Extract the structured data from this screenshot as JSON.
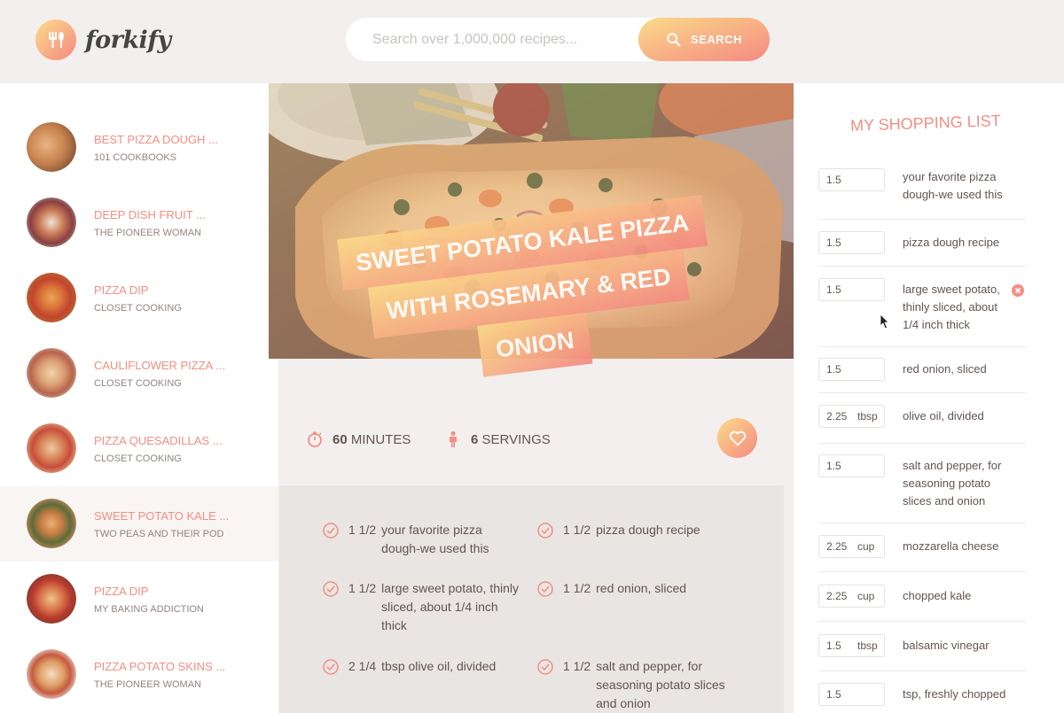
{
  "app": {
    "name": "forkify"
  },
  "search": {
    "placeholder": "Search over 1,000,000 recipes...",
    "button_label": "SEARCH"
  },
  "results": [
    {
      "title": "BEST PIZZA DOUGH ...",
      "publisher": "101 COOKBOOKS"
    },
    {
      "title": "DEEP DISH FRUIT ...",
      "publisher": "THE PIONEER WOMAN"
    },
    {
      "title": "PIZZA DIP",
      "publisher": "CLOSET COOKING"
    },
    {
      "title": "CAULIFLOWER PIZZA ...",
      "publisher": "CLOSET COOKING"
    },
    {
      "title": "PIZZA QUESADILLAS ...",
      "publisher": "CLOSET COOKING"
    },
    {
      "title": "SWEET POTATO KALE ...",
      "publisher": "TWO PEAS AND THEIR POD"
    },
    {
      "title": "PIZZA DIP",
      "publisher": "MY BAKING ADDICTION"
    },
    {
      "title": "PIZZA POTATO SKINS ...",
      "publisher": "THE PIONEER WOMAN"
    }
  ],
  "recipe": {
    "title_lines": [
      "SWEET POTATO KALE PIZZA",
      "WITH ROSEMARY & RED",
      "ONION"
    ],
    "minutes_value": "60",
    "minutes_label": "MINUTES",
    "servings_value": "6",
    "servings_label": "SERVINGS",
    "ingredients": [
      {
        "qty": "1 1/2",
        "desc": "your favorite pizza dough-we used this"
      },
      {
        "qty": "1 1/2",
        "desc": "pizza dough recipe"
      },
      {
        "qty": "1 1/2",
        "desc": "large sweet potato, thinly sliced, about 1/4 inch thick"
      },
      {
        "qty": "1 1/2",
        "desc": "red onion, sliced"
      },
      {
        "qty": "2 1/4",
        "desc": "tbsp olive oil, divided"
      },
      {
        "qty": "1 1/2",
        "desc": "salt and pepper, for seasoning potato slices and onion"
      }
    ]
  },
  "shopping": {
    "title": "MY SHOPPING LIST",
    "items": [
      {
        "count": "1.5",
        "unit": "",
        "desc": "your favorite pizza dough-we used this"
      },
      {
        "count": "1.5",
        "unit": "",
        "desc": "pizza dough recipe"
      },
      {
        "count": "1.5",
        "unit": "",
        "desc": "large sweet potato, thinly sliced, about 1/4 inch thick"
      },
      {
        "count": "1.5",
        "unit": "",
        "desc": "red onion, sliced"
      },
      {
        "count": "2.25",
        "unit": "tbsp",
        "desc": "olive oil, divided"
      },
      {
        "count": "1.5",
        "unit": "",
        "desc": "salt and pepper, for seasoning potato slices and onion"
      },
      {
        "count": "2.25",
        "unit": "cup",
        "desc": "mozzarella cheese"
      },
      {
        "count": "2.25",
        "unit": "cup",
        "desc": "chopped kale"
      },
      {
        "count": "1.5",
        "unit": "tbsp",
        "desc": "balsamic vinegar"
      },
      {
        "count": "1.5",
        "unit": "",
        "desc": "tsp, freshly chopped"
      }
    ]
  },
  "colors": {
    "accent": "#f38e82",
    "gradient_start": "#fbdb89",
    "gradient_end": "#f48982"
  }
}
